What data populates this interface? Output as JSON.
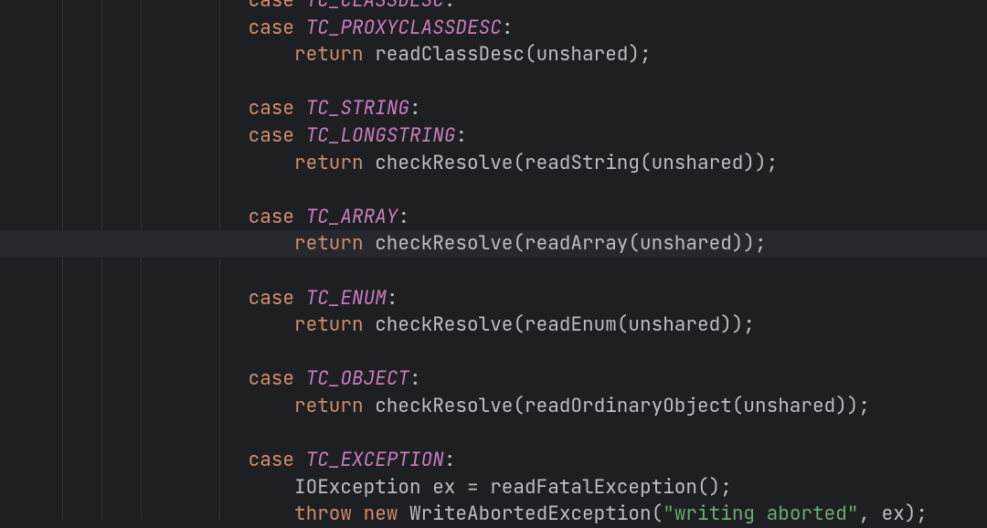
{
  "indentGuides": [
    68,
    111,
    154,
    240
  ],
  "highlightedLine": 9,
  "startOffset": -14,
  "lines": [
    {
      "indent": 4,
      "tokens": [
        {
          "t": "kw",
          "v": "case"
        },
        {
          "t": "punct",
          "v": " "
        },
        {
          "t": "cons",
          "v": "TC_CLASSDESC"
        },
        {
          "t": "punct",
          "v": ":"
        }
      ]
    },
    {
      "indent": 4,
      "tokens": [
        {
          "t": "kw",
          "v": "case"
        },
        {
          "t": "punct",
          "v": " "
        },
        {
          "t": "cons",
          "v": "TC_PROXYCLASSDESC"
        },
        {
          "t": "punct",
          "v": ":"
        }
      ]
    },
    {
      "indent": 5,
      "tokens": [
        {
          "t": "kw",
          "v": "return"
        },
        {
          "t": "punct",
          "v": " readClassDesc(unshared);"
        }
      ]
    },
    {
      "indent": 0,
      "tokens": []
    },
    {
      "indent": 4,
      "tokens": [
        {
          "t": "kw",
          "v": "case"
        },
        {
          "t": "punct",
          "v": " "
        },
        {
          "t": "cons",
          "v": "TC_STRING"
        },
        {
          "t": "punct",
          "v": ":"
        }
      ]
    },
    {
      "indent": 4,
      "tokens": [
        {
          "t": "kw",
          "v": "case"
        },
        {
          "t": "punct",
          "v": " "
        },
        {
          "t": "cons",
          "v": "TC_LONGSTRING"
        },
        {
          "t": "punct",
          "v": ":"
        }
      ]
    },
    {
      "indent": 5,
      "tokens": [
        {
          "t": "kw",
          "v": "return"
        },
        {
          "t": "punct",
          "v": " checkResolve(readString(unshared));"
        }
      ]
    },
    {
      "indent": 0,
      "tokens": []
    },
    {
      "indent": 4,
      "tokens": [
        {
          "t": "kw",
          "v": "case"
        },
        {
          "t": "punct",
          "v": " "
        },
        {
          "t": "cons",
          "v": "TC_ARRAY"
        },
        {
          "t": "punct",
          "v": ":"
        }
      ]
    },
    {
      "indent": 5,
      "tokens": [
        {
          "t": "kw",
          "v": "return"
        },
        {
          "t": "punct",
          "v": " checkResolve(readArray(unshared));"
        }
      ]
    },
    {
      "indent": 0,
      "tokens": []
    },
    {
      "indent": 4,
      "tokens": [
        {
          "t": "kw",
          "v": "case"
        },
        {
          "t": "punct",
          "v": " "
        },
        {
          "t": "cons",
          "v": "TC_ENUM"
        },
        {
          "t": "punct",
          "v": ":"
        }
      ]
    },
    {
      "indent": 5,
      "tokens": [
        {
          "t": "kw",
          "v": "return"
        },
        {
          "t": "punct",
          "v": " checkResolve(readEnum(unshared));"
        }
      ]
    },
    {
      "indent": 0,
      "tokens": []
    },
    {
      "indent": 4,
      "tokens": [
        {
          "t": "kw",
          "v": "case"
        },
        {
          "t": "punct",
          "v": " "
        },
        {
          "t": "cons",
          "v": "TC_OBJECT"
        },
        {
          "t": "punct",
          "v": ":"
        }
      ]
    },
    {
      "indent": 5,
      "tokens": [
        {
          "t": "kw",
          "v": "return"
        },
        {
          "t": "punct",
          "v": " checkResolve(readOrdinaryObject(unshared));"
        }
      ]
    },
    {
      "indent": 0,
      "tokens": []
    },
    {
      "indent": 4,
      "tokens": [
        {
          "t": "kw",
          "v": "case"
        },
        {
          "t": "punct",
          "v": " "
        },
        {
          "t": "cons",
          "v": "TC_EXCEPTION"
        },
        {
          "t": "punct",
          "v": ":"
        }
      ]
    },
    {
      "indent": 5,
      "tokens": [
        {
          "t": "punct",
          "v": "IOException ex = readFatalException();"
        }
      ]
    },
    {
      "indent": 5,
      "tokens": [
        {
          "t": "kw",
          "v": "throw"
        },
        {
          "t": "punct",
          "v": " "
        },
        {
          "t": "kw",
          "v": "new"
        },
        {
          "t": "punct",
          "v": " WriteAbortedException("
        },
        {
          "t": "str",
          "v": "\"writing aborted\""
        },
        {
          "t": "punct",
          "v": ", ex);"
        }
      ]
    }
  ]
}
